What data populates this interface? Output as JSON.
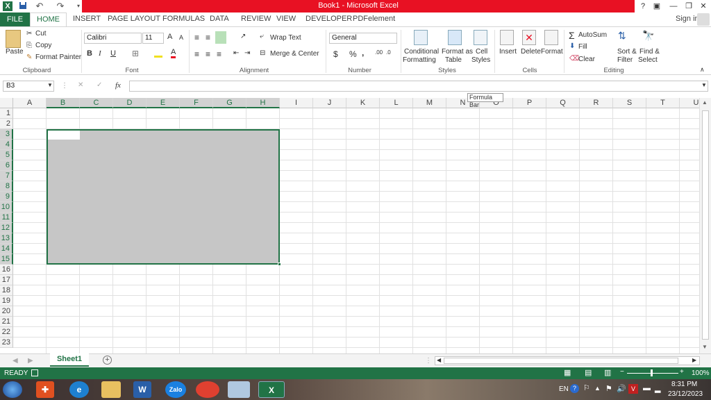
{
  "window": {
    "title": "Book1 -  Microsoft Excel"
  },
  "titlebar": {
    "help": "?",
    "restore_ribbon": "▣",
    "minimize": "—",
    "maximize": "❐",
    "close": "✕"
  },
  "quick_access": {
    "app_icon": "X",
    "save": "💾",
    "undo": "↶",
    "redo": "↷"
  },
  "tabs": [
    "FILE",
    "HOME",
    "INSERT",
    "PAGE LAYOUT",
    "FORMULAS",
    "DATA",
    "REVIEW",
    "VIEW",
    "DEVELOPER",
    "PDFelement"
  ],
  "sign_in": "Sign in",
  "clipboard": {
    "paste": "Paste",
    "cut": "Cut",
    "copy": "Copy",
    "format_painter": "Format Painter",
    "label": "Clipboard"
  },
  "font": {
    "name": "Calibri",
    "size": "11",
    "bold": "B",
    "italic": "I",
    "underline": "U",
    "label": "Font",
    "grow": "A",
    "shrink": "A"
  },
  "alignment": {
    "wrap_text": "Wrap Text",
    "merge_center": "Merge & Center",
    "label": "Alignment"
  },
  "number": {
    "format": "General",
    "currency": "$",
    "percent": "%",
    "comma": ",",
    "inc_dec": ".00",
    "dec_dec": ".0",
    "label": "Number"
  },
  "styles": {
    "conditional_1": "Conditional",
    "conditional_2": "Formatting",
    "format_table_1": "Format as",
    "format_table_2": "Table",
    "cell_styles_1": "Cell",
    "cell_styles_2": "Styles",
    "label": "Styles"
  },
  "cells": {
    "insert": "Insert",
    "delete": "Delete",
    "format": "Format",
    "label": "Cells"
  },
  "editing": {
    "autosum": "AutoSum",
    "fill": "Fill",
    "clear": "Clear",
    "sort_1": "Sort &",
    "sort_2": "Filter",
    "find_1": "Find &",
    "find_2": "Select",
    "label": "Editing"
  },
  "formula_bar": {
    "name_box": "B3",
    "fx": "fx",
    "cancel": "✕",
    "enter": "✓",
    "value": "",
    "tooltip": "Formula Bar"
  },
  "columns": [
    "A",
    "B",
    "C",
    "D",
    "E",
    "F",
    "G",
    "H",
    "I",
    "J",
    "K",
    "L",
    "M",
    "N",
    "O",
    "P",
    "Q",
    "R",
    "S",
    "T",
    "U"
  ],
  "selected_columns": [
    "B",
    "C",
    "D",
    "E",
    "F",
    "G",
    "H"
  ],
  "rows": [
    "1",
    "2",
    "3",
    "4",
    "5",
    "6",
    "7",
    "8",
    "9",
    "10",
    "11",
    "12",
    "13",
    "14",
    "15",
    "16",
    "17",
    "18",
    "19",
    "20",
    "21",
    "22",
    "23"
  ],
  "selected_rows": [
    "3",
    "4",
    "5",
    "6",
    "7",
    "8",
    "9",
    "10",
    "11",
    "12",
    "13",
    "14",
    "15"
  ],
  "selection": {
    "range": "B3:H15",
    "active_cell": "B3"
  },
  "sheet_tabs": [
    "Sheet1"
  ],
  "add_sheet": "+",
  "status": {
    "ready": "READY",
    "zoom": "100%",
    "zoom_minus": "−",
    "zoom_plus": "+"
  },
  "taskbar": {
    "lang": "EN",
    "time": "8:31 PM",
    "date": "23/12/2023",
    "apps": [
      "start",
      "shield",
      "ie",
      "explorer",
      "word",
      "zalo",
      "chrome",
      "paint",
      "excel"
    ],
    "word_label": "W",
    "zalo_label": "Zalo",
    "excel_label": "X"
  },
  "colors": {
    "excel_green": "#217346",
    "title_red": "#e81123",
    "selection_fill": "#c6c6c6"
  }
}
